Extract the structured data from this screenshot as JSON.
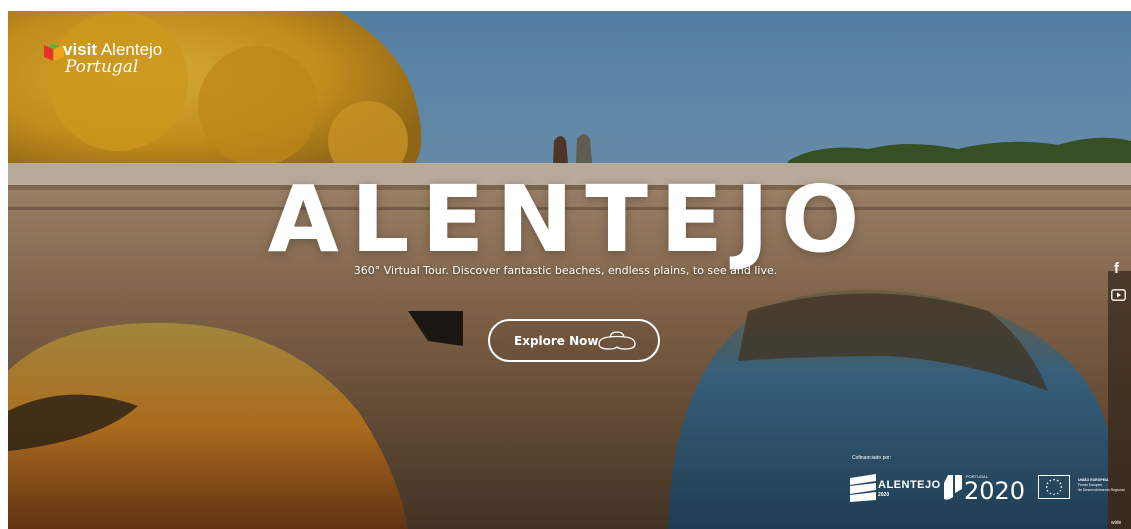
{
  "logo": {
    "line1_prefix": "visit",
    "line1_suffix": "Alentejo",
    "line2": "Portugal"
  },
  "hero": {
    "title": "ALENTEJO",
    "subtitle": "360° Virtual Tour. Discover fantastic beaches, endless plains, to see and live.",
    "cta_label": "Explore Now",
    "cta_icon": "vr-headset-icon"
  },
  "social": {
    "facebook_label": "f",
    "facebook_icon": "facebook-icon",
    "youtube_icon": "youtube-icon"
  },
  "partners": {
    "cofinanced_label": "Cofinanciado por:",
    "alentejo_name": "ALENTEJO",
    "alentejo_year": "2020",
    "portugal_label": "PORTUGAL",
    "portugal_year": "2020",
    "eu_lines": [
      "UNIÃO EUROPEIA",
      "Fundo Europeu",
      "de Desenvolvimento Regional"
    ]
  },
  "watermark": "wide",
  "colors": {
    "text": "#ffffff",
    "sky": "#7ba6c4",
    "stone": "#8a6a4c",
    "foliage": "#e2a418",
    "water": "#3e6b88"
  }
}
